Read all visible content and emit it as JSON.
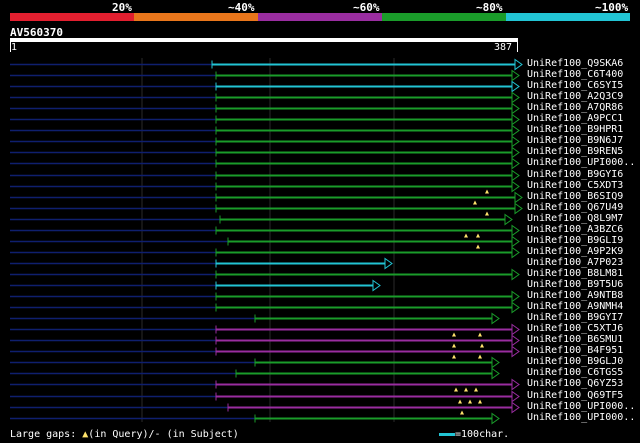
{
  "legend": {
    "labels": [
      "20%",
      "~40%",
      "~60%",
      "~80%",
      "~100%"
    ],
    "colors": [
      "#e21f2f",
      "#e9761b",
      "#9a2da0",
      "#1a9c2a",
      "#22c4d4"
    ]
  },
  "query": {
    "name": "AV560370",
    "start": "1",
    "end": "387"
  },
  "footer": {
    "large_gaps": "Large gaps:",
    "in_query": "(in Query)/-",
    "in_subject": "(in Subject)",
    "scale": "=100char."
  },
  "hits": [
    {
      "label": "UniRef100_Q9SKA6",
      "color": "cyan"
    },
    {
      "label": "UniRef100_C6T400",
      "color": "green"
    },
    {
      "label": "UniRef100_C6SYI5",
      "color": "cyan"
    },
    {
      "label": "UniRef100_A2Q3C9",
      "color": "green"
    },
    {
      "label": "UniRef100_A7QR86",
      "color": "green"
    },
    {
      "label": "UniRef100_A9PCC1",
      "color": "green"
    },
    {
      "label": "UniRef100_B9HPR1",
      "color": "green"
    },
    {
      "label": "UniRef100_B9N6J7",
      "color": "green"
    },
    {
      "label": "UniRef100_B9REN5",
      "color": "green"
    },
    {
      "label": "UniRef100_UPI000..",
      "color": "green"
    },
    {
      "label": "UniRef100_B9GYI6",
      "color": "green"
    },
    {
      "label": "UniRef100_C5XDT3",
      "color": "green"
    },
    {
      "label": "UniRef100_B6SIQ9",
      "color": "green"
    },
    {
      "label": "UniRef100_Q67U49",
      "color": "green"
    },
    {
      "label": "UniRef100_Q8L9M7",
      "color": "green"
    },
    {
      "label": "UniRef100_A3BZC6",
      "color": "green"
    },
    {
      "label": "UniRef100_B9GLI9",
      "color": "green"
    },
    {
      "label": "UniRef100_A9P2K9",
      "color": "green"
    },
    {
      "label": "UniRef100_A7P023",
      "color": "cyan"
    },
    {
      "label": "UniRef100_B8LM81",
      "color": "green"
    },
    {
      "label": "UniRef100_B9T5U6",
      "color": "cyan"
    },
    {
      "label": "UniRef100_A9NTB8",
      "color": "green"
    },
    {
      "label": "UniRef100_A9NMH4",
      "color": "green"
    },
    {
      "label": "UniRef100_B9GYI7",
      "color": "green"
    },
    {
      "label": "UniRef100_C5XTJ6",
      "color": "purple"
    },
    {
      "label": "UniRef100_B6SMU1",
      "color": "purple"
    },
    {
      "label": "UniRef100_B4F951",
      "color": "purple"
    },
    {
      "label": "UniRef100_B9GLJ0",
      "color": "green"
    },
    {
      "label": "UniRef100_C6TGS5",
      "color": "green"
    },
    {
      "label": "UniRef100_Q6YZ53",
      "color": "purple"
    },
    {
      "label": "UniRef100_Q69TF5",
      "color": "purple"
    },
    {
      "label": "UniRef100_UPI000..",
      "color": "purple"
    },
    {
      "label": "UniRef100_UPI000..",
      "color": "green"
    }
  ]
}
